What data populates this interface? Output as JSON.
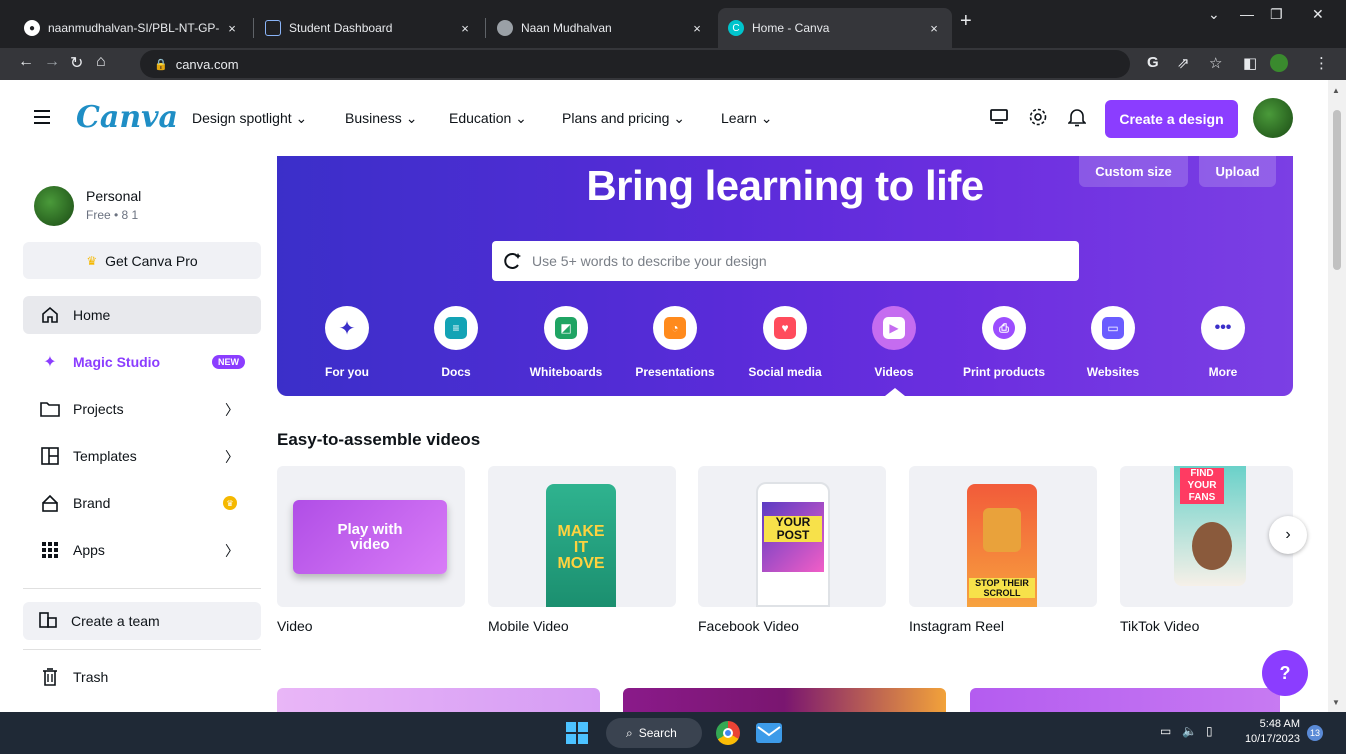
{
  "browser": {
    "tabs": [
      {
        "title": "naanmudhalvan-SI/PBL-NT-GP-",
        "close": "×"
      },
      {
        "title": "Student Dashboard",
        "close": "×"
      },
      {
        "title": "Naan Mudhalvan",
        "close": "×"
      },
      {
        "title": "Home - Canva",
        "close": "×"
      }
    ],
    "new_tab": "+",
    "url": "canva.com"
  },
  "header": {
    "logo": "Canva",
    "nav": [
      "Design spotlight ⌄",
      "Business ⌄",
      "Education ⌄",
      "Plans and pricing ⌄",
      "Learn ⌄"
    ],
    "create_label": "Create a design"
  },
  "sidebar": {
    "account_name": "Personal",
    "account_sub": "Free • 8 1",
    "get_pro": "Get Canva Pro",
    "items": [
      {
        "label": "Home",
        "icon": "home-icon"
      },
      {
        "label": "Magic Studio",
        "icon": "magic-icon",
        "badge": "NEW"
      },
      {
        "label": "Projects",
        "icon": "folder-icon"
      },
      {
        "label": "Templates",
        "icon": "templates-icon"
      },
      {
        "label": "Brand",
        "icon": "brand-icon"
      },
      {
        "label": "Apps",
        "icon": "apps-icon"
      }
    ],
    "create_team": "Create a team",
    "trash": "Trash"
  },
  "hero": {
    "title": "Bring learning to life",
    "custom_size": "Custom size",
    "upload": "Upload",
    "search_placeholder": "Use 5+ words to describe your design",
    "categories": [
      {
        "label": "For you",
        "color": "#3b2fc9"
      },
      {
        "label": "Docs",
        "color": "#13a3b5"
      },
      {
        "label": "Whiteboards",
        "color": "#1fa463"
      },
      {
        "label": "Presentations",
        "color": "#ff8a1c"
      },
      {
        "label": "Social media",
        "color": "#ff4b5c"
      },
      {
        "label": "Videos",
        "color": "#c56cf0"
      },
      {
        "label": "Print products",
        "color": "#9c4dff"
      },
      {
        "label": "Websites",
        "color": "#6a5cff"
      },
      {
        "label": "More",
        "color": "#3b2fc9"
      }
    ]
  },
  "videos": {
    "title": "Easy-to-assemble videos",
    "cards": [
      {
        "label": "Video",
        "art": "Play with video"
      },
      {
        "label": "Mobile Video",
        "art": "MAKE IT MOVE"
      },
      {
        "label": "Facebook Video",
        "art": "YOUR POST"
      },
      {
        "label": "Instagram Reel",
        "art": "STOP THEIR SCROLL"
      },
      {
        "label": "TikTok Video",
        "art": "FIND YOUR FANS"
      }
    ]
  },
  "help_label": "?",
  "taskbar": {
    "search": "Search",
    "time": "5:48 AM",
    "date": "10/17/2023",
    "notif_count": "13"
  }
}
